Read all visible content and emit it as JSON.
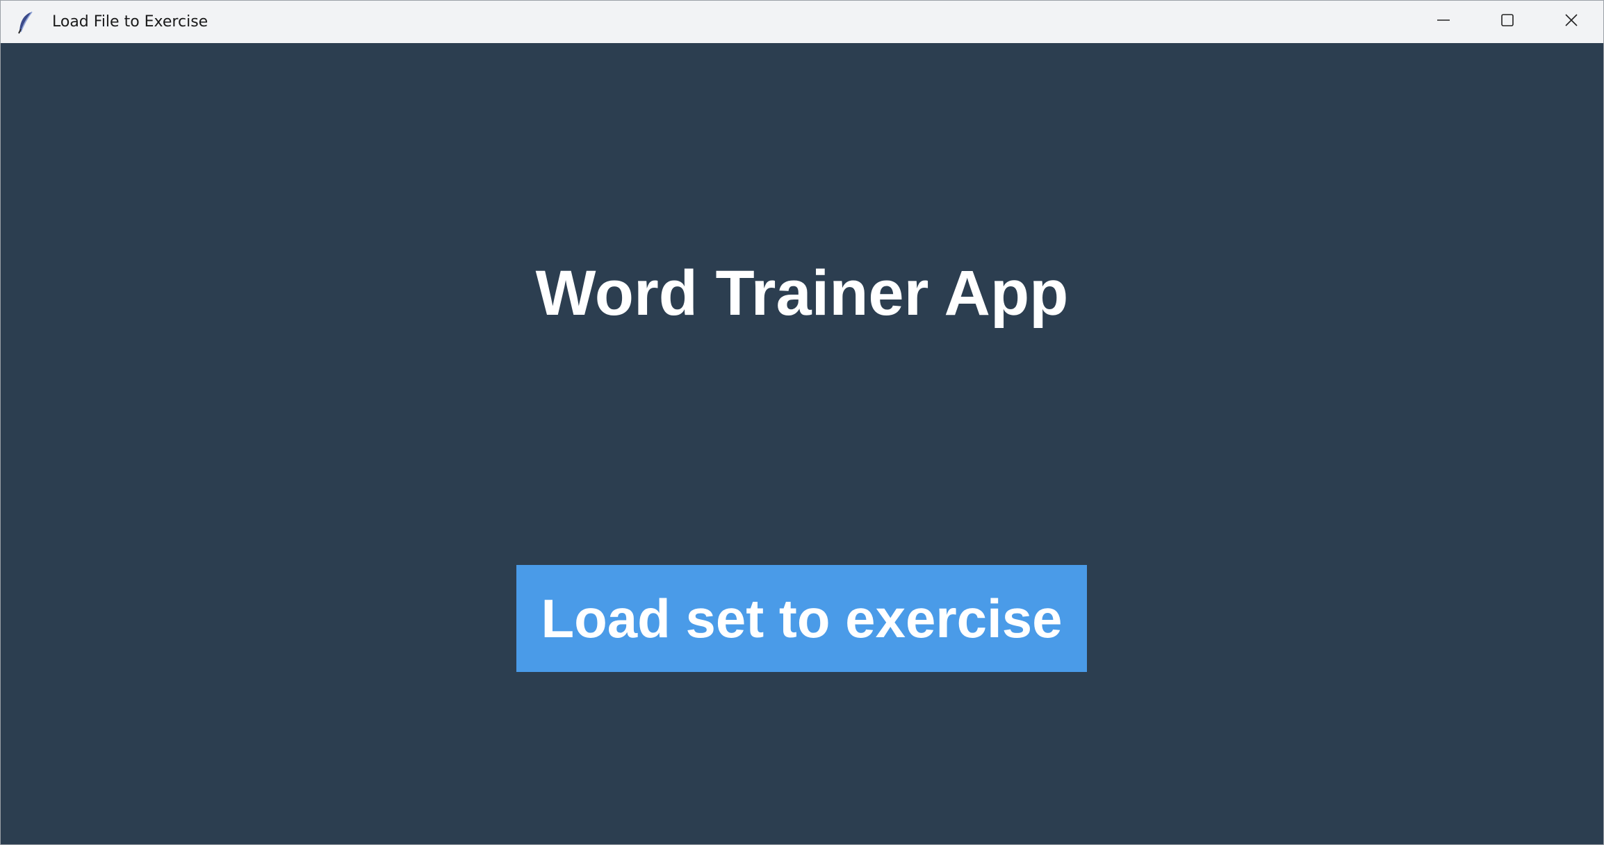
{
  "window": {
    "title": "Load File to Exercise",
    "icon": "feather-icon",
    "controls": {
      "minimize_icon": "minimize-icon",
      "maximize_icon": "maximize-icon",
      "close_icon": "close-icon"
    }
  },
  "main": {
    "heading": "Word Trainer App",
    "load_button_label": "Load set to exercise"
  },
  "colors": {
    "background": "#2c3e50",
    "button": "#4a9be8",
    "text": "#ffffff",
    "titlebar": "#f2f3f5"
  }
}
